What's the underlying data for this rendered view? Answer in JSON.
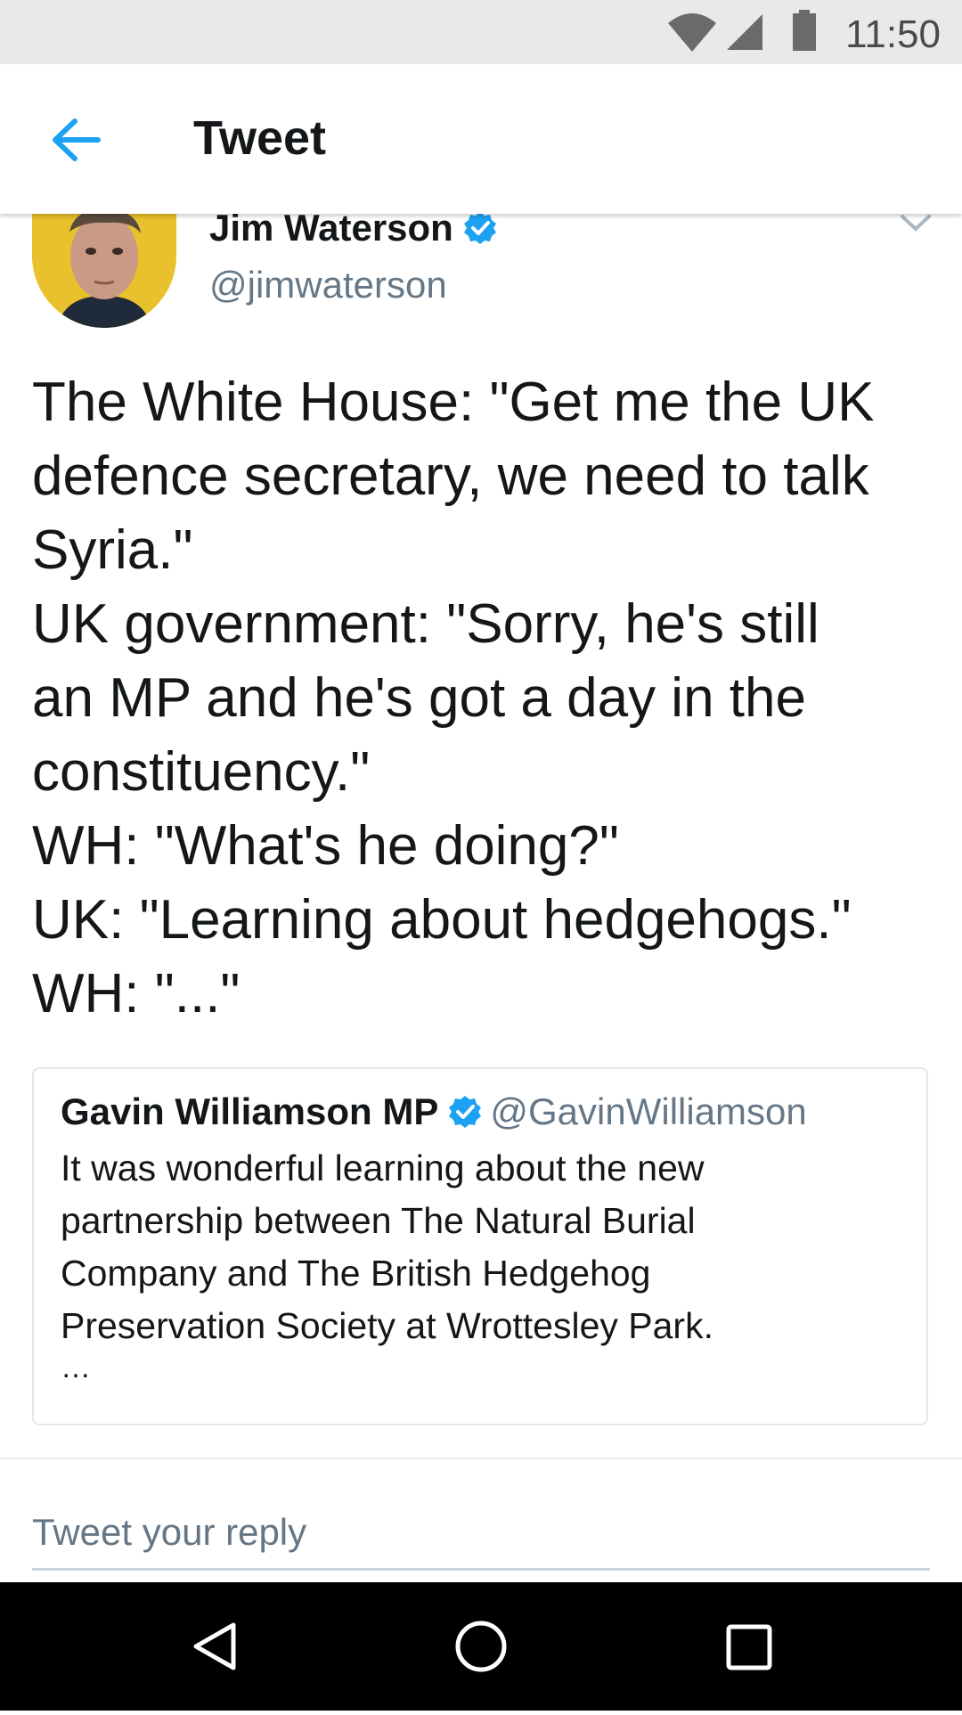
{
  "status_bar": {
    "time": "11:50",
    "icons": [
      "wifi-icon",
      "cell-signal-icon",
      "battery-icon"
    ]
  },
  "header": {
    "back_icon": "back-arrow-icon",
    "title": "Tweet"
  },
  "tweet": {
    "author_name": "Jim Waterson",
    "author_handle": "@jimwaterson",
    "verified": true,
    "lines": [
      "The White House: \"Get me the UK",
      "defence secretary, we need to talk",
      "Syria.\"",
      "UK government: \"Sorry, he's still",
      "an MP and he's got a day in the",
      "constituency.\"",
      "WH: \"What's he doing?\"",
      "UK: \"Learning about hedgehogs.\"",
      "WH: \"...\""
    ]
  },
  "quoted_tweet": {
    "author_name": "Gavin Williamson MP",
    "author_handle": "@GavinWilliamson",
    "verified": true,
    "lines": [
      "It was wonderful learning about the new",
      "partnership between The Natural Burial",
      "Company and The British Hedgehog",
      "Preservation Society at Wrottesley Park."
    ],
    "ellipsis": "…"
  },
  "reply": {
    "placeholder": "Tweet your reply"
  },
  "nav_bar": {
    "buttons": [
      "back-triangle-icon",
      "home-circle-icon",
      "recents-square-icon"
    ]
  },
  "colors": {
    "accent": "#1da1f2",
    "text": "#14171a",
    "secondary_text": "#657786",
    "status_bar_bg": "#e9e9e9",
    "nav_bar_bg": "#000000"
  }
}
